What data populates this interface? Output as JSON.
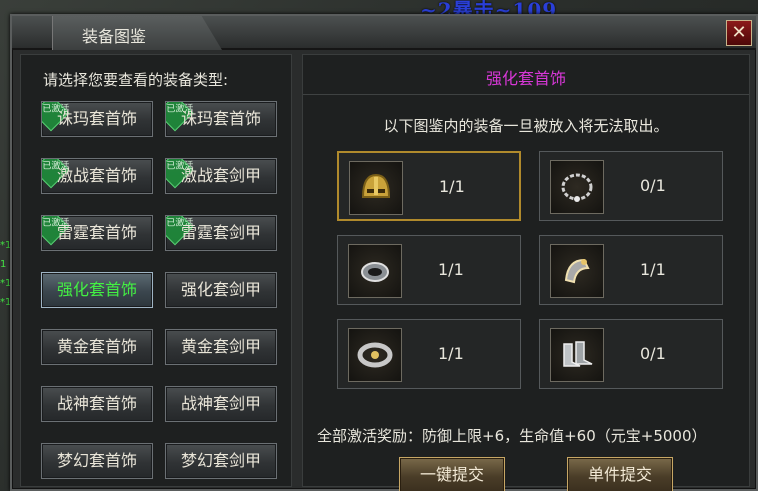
{
  "scene": {
    "damage_text": "~2暴击~109",
    "side_marks": [
      "*1",
      "1",
      "*1",
      "*1"
    ]
  },
  "window": {
    "title": "装备图鉴",
    "close_icon": "close-icon"
  },
  "left": {
    "prompt": "请选择您要查看的装备类型:",
    "categories": [
      {
        "label": "诛玛套首饰",
        "badge": "已激活",
        "active": false
      },
      {
        "label": "诛玛套首饰",
        "badge": "已激活",
        "active": false
      },
      {
        "label": "激战套首饰",
        "badge": "已激活",
        "active": false
      },
      {
        "label": "激战套剑甲",
        "badge": "已激活",
        "active": false
      },
      {
        "label": "雷霆套首饰",
        "badge": "已激活",
        "active": false
      },
      {
        "label": "雷霆套剑甲",
        "badge": "已激活",
        "active": false
      },
      {
        "label": "强化套首饰",
        "badge": "",
        "active": true
      },
      {
        "label": "强化套剑甲",
        "badge": "",
        "active": false
      },
      {
        "label": "黄金套首饰",
        "badge": "",
        "active": false
      },
      {
        "label": "黄金套剑甲",
        "badge": "",
        "active": false
      },
      {
        "label": "战神套首饰",
        "badge": "",
        "active": false
      },
      {
        "label": "战神套剑甲",
        "badge": "",
        "active": false
      },
      {
        "label": "梦幻套首饰",
        "badge": "",
        "active": false
      },
      {
        "label": "梦幻套剑甲",
        "badge": "",
        "active": false
      }
    ]
  },
  "right": {
    "set_title": "强化套首饰",
    "note": "以下图鉴内的装备一旦被放入将无法取出。",
    "slots": [
      {
        "item": "helmet-icon",
        "count": "1/1"
      },
      {
        "item": "necklace-icon",
        "count": "0/1"
      },
      {
        "item": "bracelet-icon",
        "count": "1/1"
      },
      {
        "item": "ring-icon",
        "count": "1/1"
      },
      {
        "item": "belt-icon",
        "count": "1/1"
      },
      {
        "item": "boots-icon",
        "count": "0/1"
      }
    ],
    "reward": "全部激活奖励：防御上限+6，生命值+60（元宝+5000）",
    "buttons": {
      "submit_all": "一键提交",
      "submit_one": "单件提交"
    }
  },
  "colors": {
    "title_magenta": "#d637d6",
    "active_green": "#43f043",
    "slot_highlight": "#b08a2c"
  }
}
